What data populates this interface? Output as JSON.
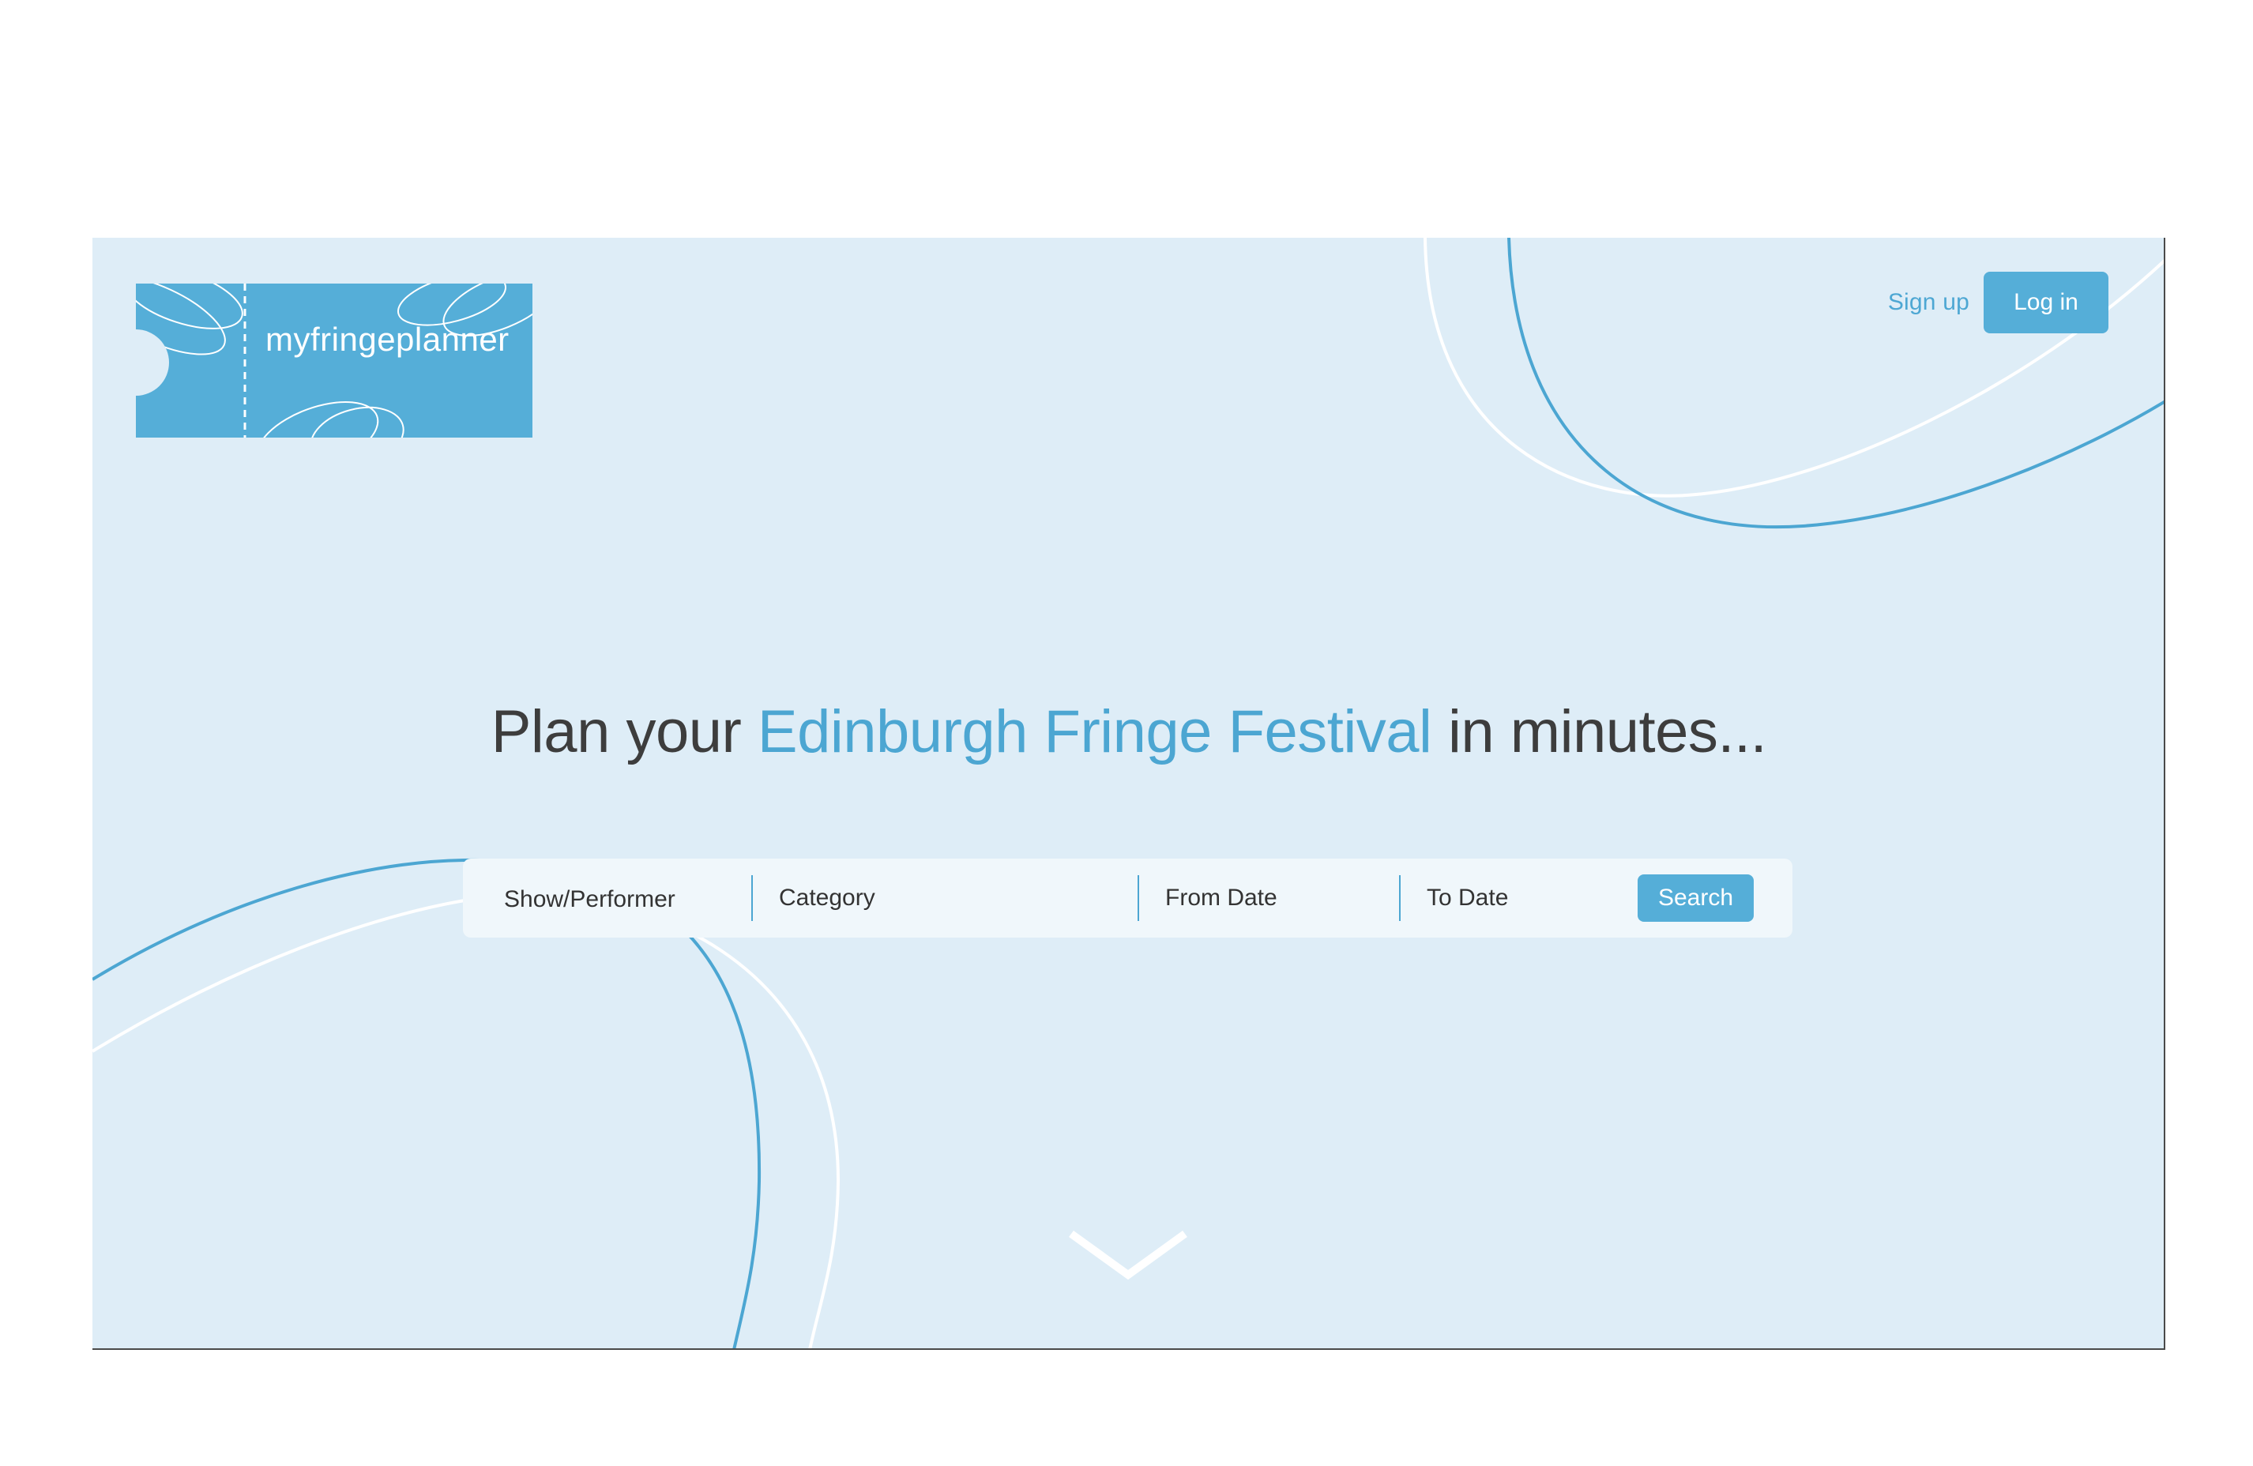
{
  "brand": {
    "logo_text": "myfringeplanner"
  },
  "nav": {
    "signup_label": "Sign up",
    "login_label": "Log in"
  },
  "hero": {
    "headline_part1": "Plan your ",
    "headline_accent": "Edinburgh Fringe Festival",
    "headline_part2": " in minutes..."
  },
  "search": {
    "show_performer_placeholder": "Show/Performer",
    "category_placeholder": "Category",
    "from_date_placeholder": "From Date",
    "to_date_placeholder": "To Date",
    "search_label": "Search"
  },
  "icons": {
    "scroll": "chevron-down-icon"
  },
  "colors": {
    "accent": "#55aed8",
    "accent_text": "#4ca6d2",
    "background": "#deedf7",
    "searchbar_bg": "#f0f7fb",
    "headline": "#3d3d3d"
  }
}
